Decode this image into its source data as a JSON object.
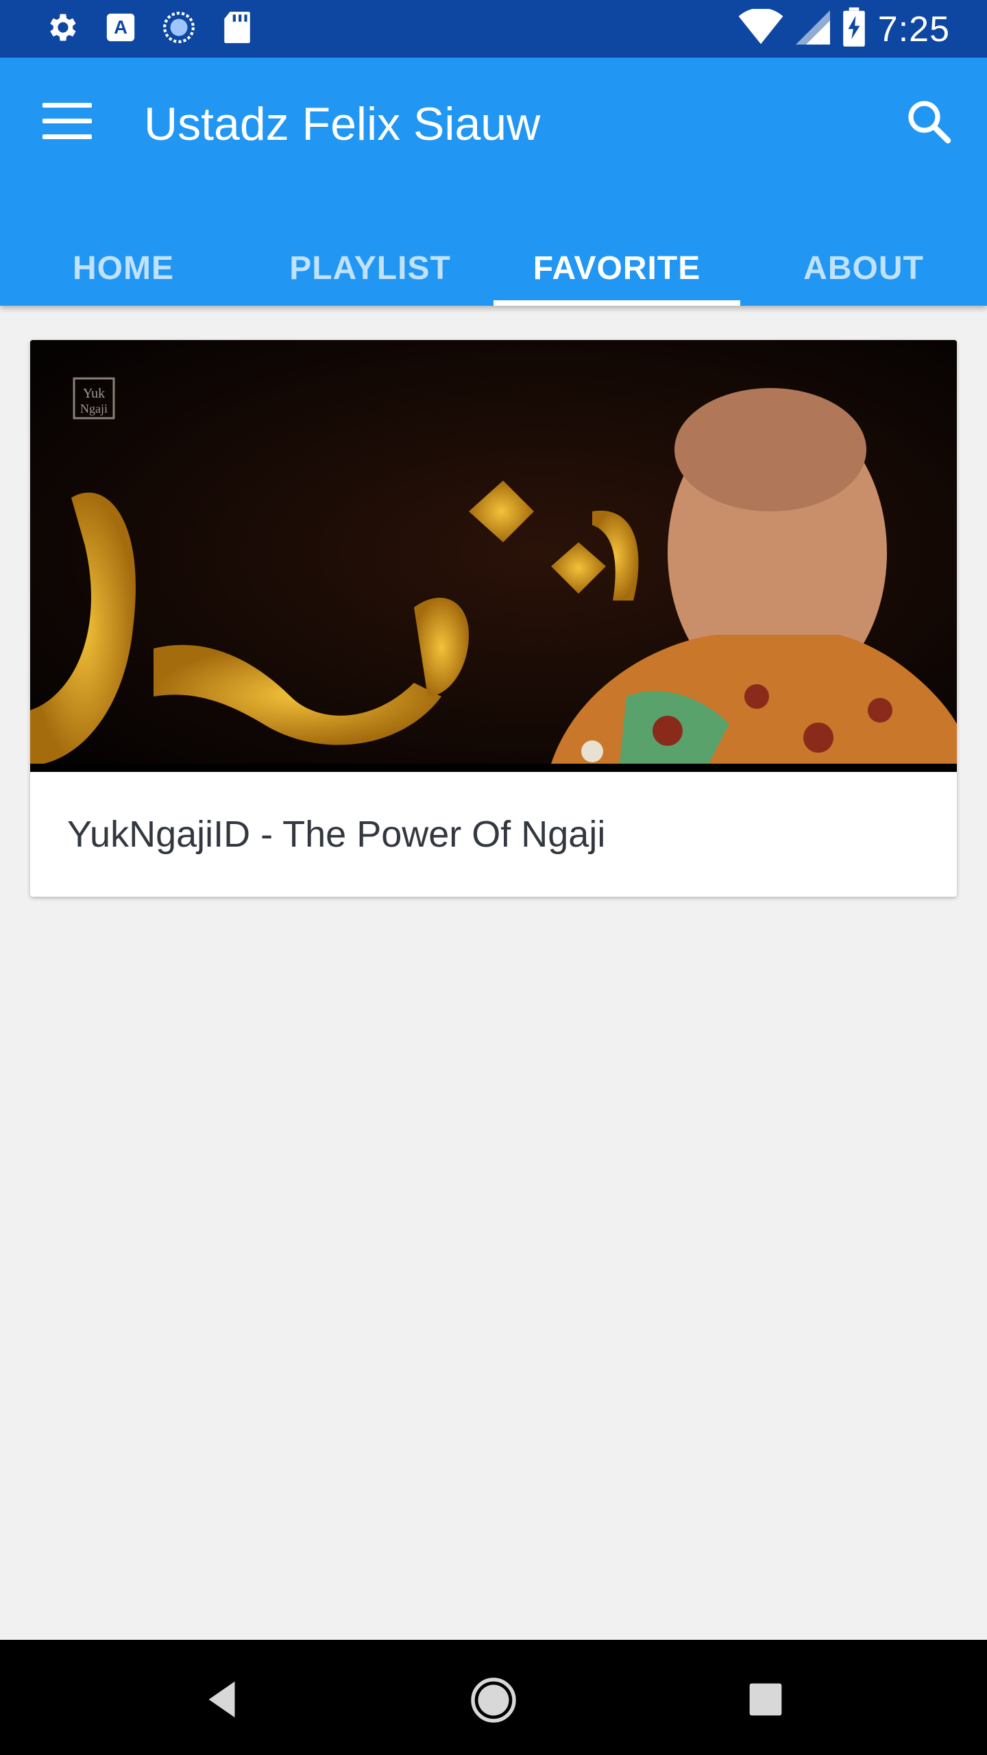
{
  "status_bar": {
    "time": "7:25",
    "left_icons": [
      "settings-icon",
      "a-notification-icon",
      "loading-icon",
      "sd-card-icon"
    ],
    "right_icons": [
      "wifi-icon",
      "signal-icon",
      "battery-charging-icon"
    ]
  },
  "app_bar": {
    "title": "Ustadz Felix Siauw",
    "menu_icon": "menu-icon",
    "search_icon": "search-icon"
  },
  "tabs": [
    {
      "label": "HOME",
      "active": false
    },
    {
      "label": "PLAYLIST",
      "active": false
    },
    {
      "label": "FAVORITE",
      "active": true
    },
    {
      "label": "ABOUT",
      "active": false
    }
  ],
  "favorites": [
    {
      "title": "YukNgajiID - The Power Of Ngaji",
      "thumbnail_logo": "Yuk Ngaji"
    }
  ],
  "nav_bar": {
    "buttons": [
      "back-icon",
      "home-icon",
      "recents-icon"
    ]
  },
  "colors": {
    "status_bar": "#0d47a1",
    "app_bar": "#2196f3",
    "background": "#f1f1f1"
  }
}
